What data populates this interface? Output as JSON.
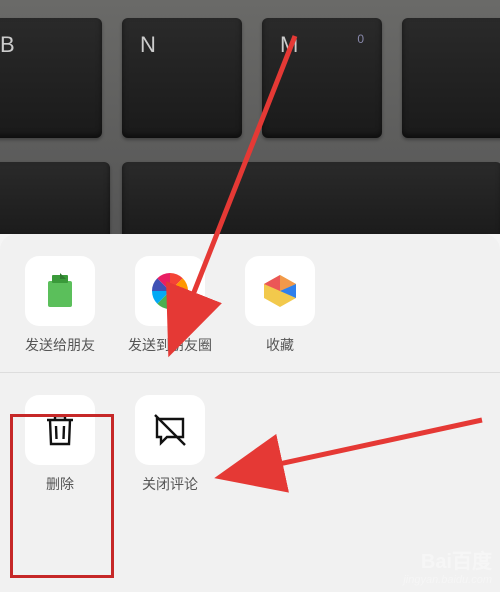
{
  "background": {
    "keys": [
      "B",
      "N",
      "M"
    ],
    "indicator": "0"
  },
  "sheet": {
    "row1": [
      {
        "id": "send-to-friend",
        "label": "发送给朋友"
      },
      {
        "id": "send-to-moments",
        "label": "发送到朋友圈"
      },
      {
        "id": "favorite",
        "label": "收藏"
      }
    ],
    "row2": [
      {
        "id": "delete",
        "label": "删除"
      },
      {
        "id": "close-comments",
        "label": "关闭评论"
      }
    ]
  },
  "watermark": {
    "logo": "Bai百度",
    "sub": "jingyan.baidu.com"
  }
}
